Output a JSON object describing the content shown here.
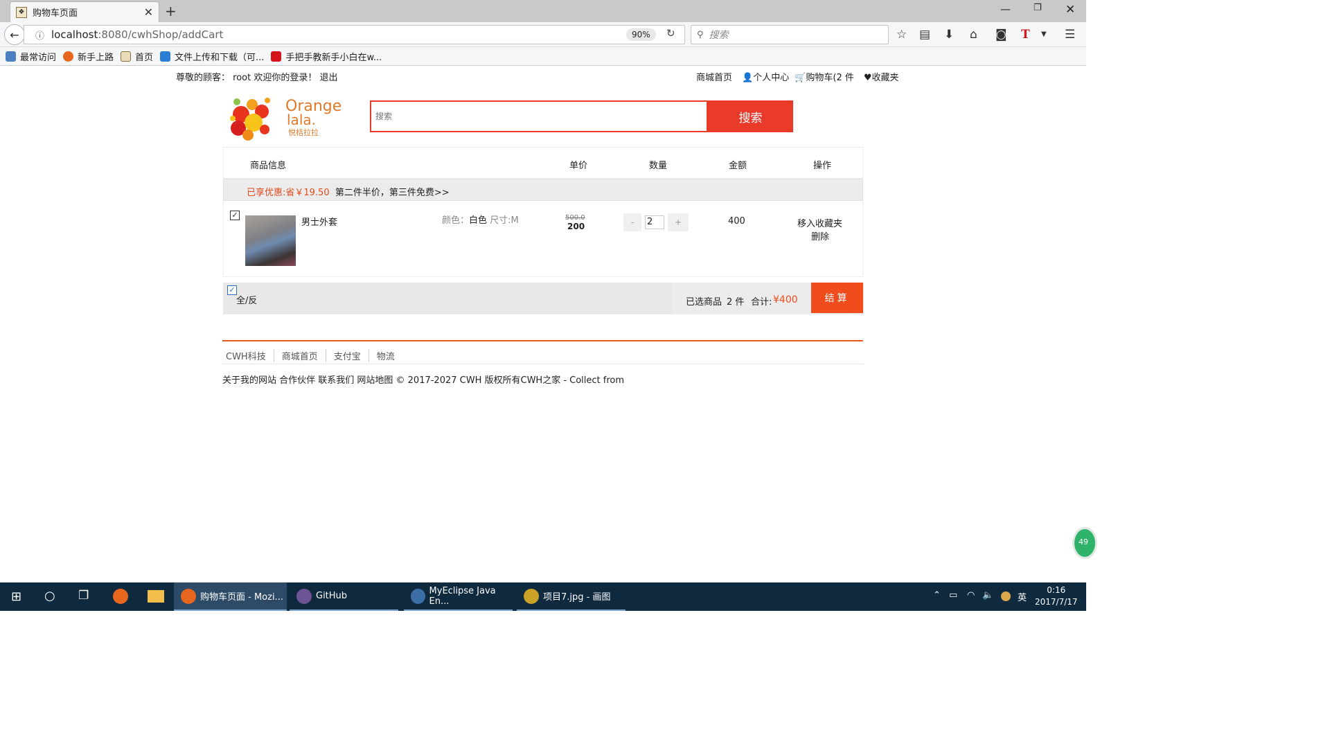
{
  "browser": {
    "tab_title": "购物车页面",
    "url_host": "localhost",
    "url_rest": ":8080/cwhShop/addCart",
    "zoom": "90%",
    "search_placeholder": "搜索",
    "bookmarks": [
      {
        "label": "最常访问",
        "color": "#4a7fc1"
      },
      {
        "label": "新手上路",
        "color": "#e8661d"
      },
      {
        "label": "首页",
        "color": "#8a6d3b"
      },
      {
        "label": "文件上传和下载（可...",
        "color": "#2b7cd3"
      },
      {
        "label": "手把手教新手小白在w...",
        "color": "#d3141b"
      }
    ]
  },
  "page": {
    "greeting": "尊敬的顾客： root 欢迎你的登录！ 退出",
    "nav": {
      "home": "商城首页",
      "user_center": "个人中心",
      "cart": "购物车(2 件",
      "favorites": "收藏夹"
    },
    "logo": {
      "line1": "Orange",
      "line2": "lala.",
      "tagline": "悦桔拉拉"
    },
    "search_placeholder": "搜索",
    "search_button": "搜索",
    "cart": {
      "headers": {
        "info": "商品信息",
        "price": "单价",
        "qty": "数量",
        "amount": "金额",
        "ops": "操作"
      },
      "promo_highlight": "已享优惠:省￥19.50",
      "promo_text": "第二件半价，第三件免费>>",
      "item": {
        "name": "男士外套",
        "color_label": "颜色：",
        "color_value": "白色",
        "size": "尺寸:M",
        "old_price": "500.0",
        "price": "200",
        "minus": "-",
        "qty": "2",
        "plus": "+",
        "amount": "400",
        "move_fav": "移入收藏夹",
        "delete": "删除",
        "checked": true
      },
      "select_all": "全/反",
      "selected_label": "已选商品",
      "selected_count": "2 件",
      "total_label": "合计:",
      "total_value": "¥400",
      "checkout": "结算"
    },
    "footer": {
      "links": [
        "CWH科技",
        "商城首页",
        "支付宝",
        "物流"
      ],
      "copyright": "关于我的网站 合作伙伴 联系我们 网站地图 © 2017-2027 CWH 版权所有CWH之家 - Collect from"
    },
    "float_badge": "49",
    "accent_color": "#e93a2a"
  },
  "taskbar": {
    "items": [
      {
        "label": "购物车页面 - Mozi...",
        "color": "#e8661d"
      },
      {
        "label": "GitHub",
        "color": "#6e5494"
      },
      {
        "label": "MyEclipse Java En...",
        "color": "#3a6ea5"
      },
      {
        "label": "项目7.jpg - 画图",
        "color": "#c9a227"
      }
    ],
    "ime": "英",
    "time": "0:16",
    "date": "2017/7/17"
  }
}
